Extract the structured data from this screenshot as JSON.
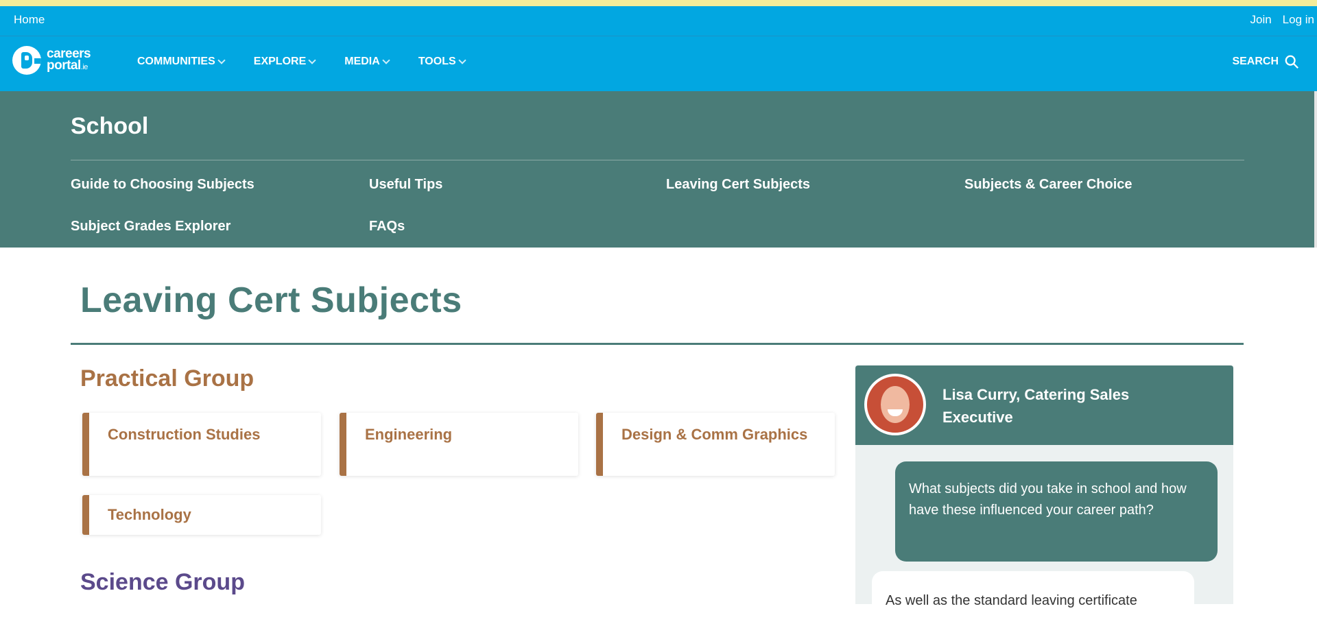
{
  "util": {
    "home": "Home",
    "join": "Join",
    "login": "Log in"
  },
  "logo": {
    "line1": "careers",
    "line2": "portal",
    "suffix": ".ie"
  },
  "nav": {
    "items": [
      "COMMUNITIES",
      "EXPLORE",
      "MEDIA",
      "TOOLS"
    ],
    "search": "SEARCH"
  },
  "school": {
    "title": "School",
    "links": [
      "Guide to Choosing Subjects",
      "Useful Tips",
      "Leaving Cert Subjects",
      "Subjects & Career Choice",
      "Subject Grades Explorer",
      "FAQs"
    ]
  },
  "page": {
    "title": "Leaving Cert Subjects"
  },
  "groups": {
    "practical": {
      "title": "Practical Group",
      "color": "#a97245",
      "subjects": [
        "Construction Studies",
        "Engineering",
        "Design & Comm Graphics",
        "Technology"
      ]
    },
    "science": {
      "title": "Science Group",
      "color": "#5b4a8b"
    }
  },
  "sidebar": {
    "name": "Lisa Curry, Catering Sales Executive",
    "question": "What subjects did you take in school and how have these influenced your career path?",
    "answer": "As well as the standard leaving certificate"
  },
  "colors": {
    "brand_blue": "#02a7e1",
    "teal": "#4a7c78",
    "bronze": "#a97245",
    "purple": "#5b4a8b"
  }
}
